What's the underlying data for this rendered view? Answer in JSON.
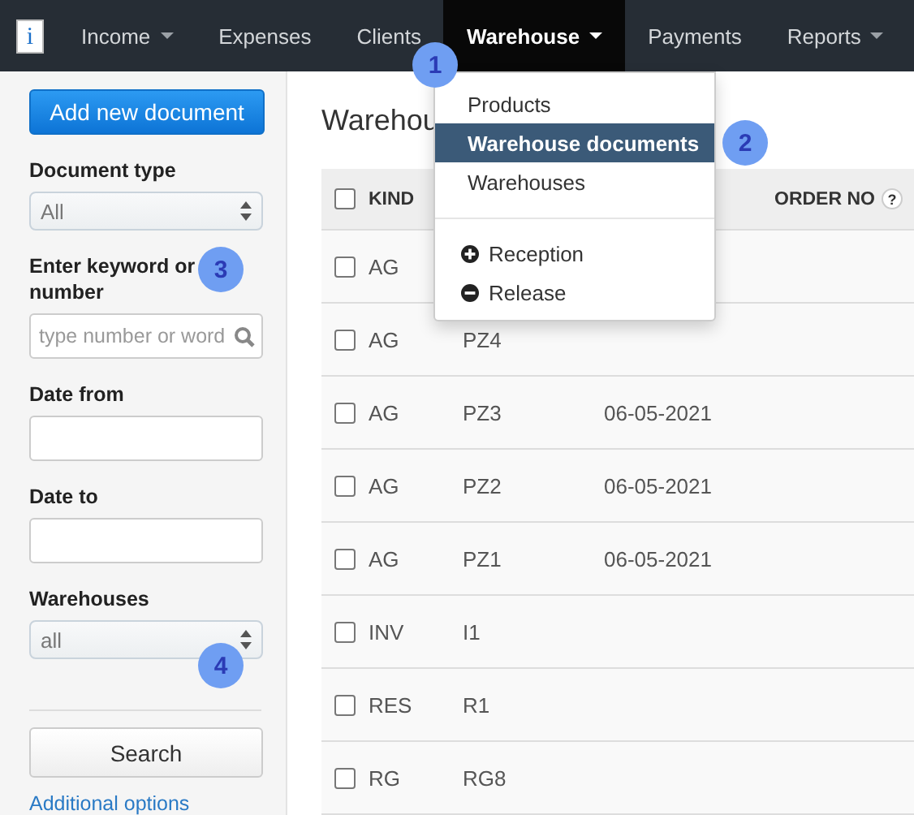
{
  "nav": {
    "logo": "i",
    "items": [
      {
        "label": "Income",
        "dropdown": true,
        "selected": false
      },
      {
        "label": "Expenses",
        "dropdown": false,
        "selected": false
      },
      {
        "label": "Clients",
        "dropdown": false,
        "selected": false
      },
      {
        "label": "Warehouse",
        "dropdown": true,
        "selected": true
      },
      {
        "label": "Payments",
        "dropdown": false,
        "selected": false
      },
      {
        "label": "Reports",
        "dropdown": true,
        "selected": false
      }
    ]
  },
  "menu": {
    "items": [
      {
        "kind": "link",
        "label": "Products",
        "selected": false
      },
      {
        "kind": "link",
        "label": "Warehouse documents",
        "selected": true
      },
      {
        "kind": "link",
        "label": "Warehouses",
        "selected": false
      },
      {
        "kind": "divider"
      },
      {
        "kind": "action",
        "label": "Reception"
      },
      {
        "kind": "action",
        "label": "Release"
      }
    ]
  },
  "sidebar": {
    "add_button": "Add new document",
    "fields": [
      {
        "kind": "select",
        "label": "Document type",
        "value": "All"
      },
      {
        "kind": "search",
        "label": "Enter keyword or number",
        "placeholder": "type number or word"
      },
      {
        "kind": "text",
        "label": "Date from"
      },
      {
        "kind": "text",
        "label": "Date to"
      },
      {
        "kind": "select",
        "label": "Warehouses",
        "value": "all"
      }
    ],
    "search_button": "Search",
    "link": "Additional options"
  },
  "main": {
    "title": "Warehou",
    "select_all_checked": false,
    "columns": [
      {
        "label": "KIND",
        "help": false
      },
      {
        "label": "ORDER NO",
        "help": true,
        "help_text": "?"
      }
    ],
    "rows": [
      {
        "checked": false,
        "kind": "AG"
      },
      {
        "checked": false,
        "kind": "AG",
        "number": "PZ4"
      },
      {
        "checked": false,
        "kind": "AG",
        "number": "PZ3",
        "date": "06-05-2021"
      },
      {
        "checked": false,
        "kind": "AG",
        "number": "PZ2",
        "date": "06-05-2021"
      },
      {
        "checked": false,
        "kind": "AG",
        "number": "PZ1",
        "date": "06-05-2021"
      },
      {
        "checked": false,
        "kind": "INV",
        "number": "I1"
      },
      {
        "checked": false,
        "kind": "RES",
        "number": "R1"
      },
      {
        "checked": false,
        "kind": "RG",
        "number": "RG8"
      }
    ]
  },
  "badges": [
    "1",
    "2",
    "3",
    "4"
  ]
}
